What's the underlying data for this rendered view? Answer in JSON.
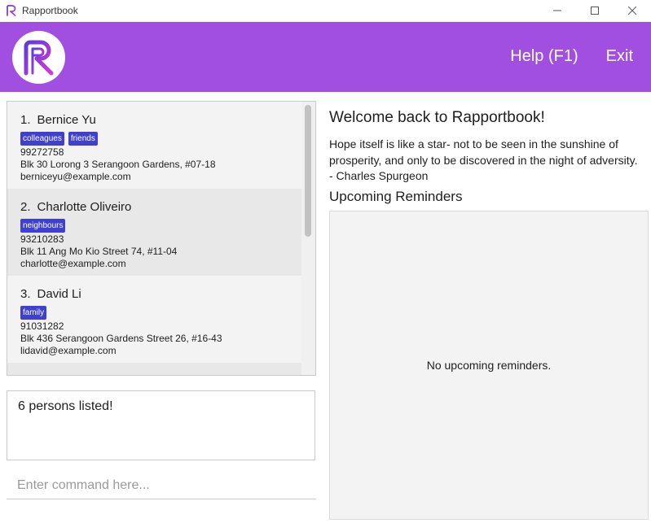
{
  "window": {
    "title": "Rapportbook",
    "controls": {
      "minimize": "—",
      "maximize": "☐",
      "close": "✕"
    }
  },
  "header": {
    "brand_color": "#a14fe0",
    "menu": [
      {
        "label": "Help (F1)"
      },
      {
        "label": "Exit"
      }
    ]
  },
  "persons": [
    {
      "index": "1.",
      "name": "Bernice Yu",
      "tags": [
        "colleagues",
        "friends"
      ],
      "phone": "99272758",
      "address": "Blk 30 Lorong 3 Serangoon Gardens, #07-18",
      "email": "berniceyu@example.com"
    },
    {
      "index": "2.",
      "name": "Charlotte Oliveiro",
      "tags": [
        "neighbours"
      ],
      "phone": "93210283",
      "address": "Blk 11 Ang Mo Kio Street 74, #11-04",
      "email": "charlotte@example.com"
    },
    {
      "index": "3.",
      "name": "David Li",
      "tags": [
        "family"
      ],
      "phone": "91031282",
      "address": "Blk 436 Serangoon Gardens Street 26, #16-43",
      "email": "lidavid@example.com"
    }
  ],
  "result_display": {
    "text": "6 persons listed!"
  },
  "command_box": {
    "placeholder": "Enter command here...",
    "value": ""
  },
  "main": {
    "welcome": "Welcome back to Rapportbook!",
    "quote": "Hope itself is like a star- not to be seen in the sunshine of prosperity, and only to be discovered in the night of adversity. - Charles Spurgeon",
    "reminders_title": "Upcoming Reminders",
    "reminders_empty": "No upcoming reminders."
  },
  "colors": {
    "tag": "#3f3fd0",
    "header": "#a14fe0"
  }
}
